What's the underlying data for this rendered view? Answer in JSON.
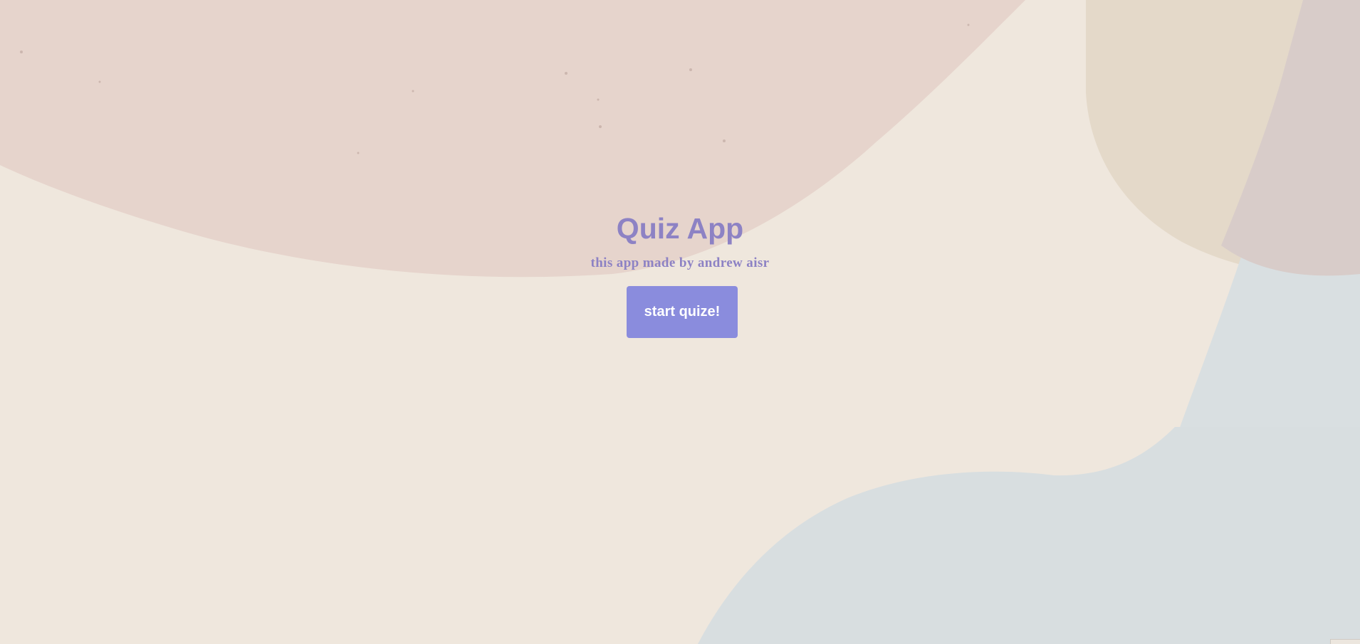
{
  "page": {
    "title": "Quiz App",
    "subtitle": "this app made by andrew aisr",
    "start_button_label": "start quize!"
  },
  "colors": {
    "background": "#efe7dd",
    "pink_blob": "#e6d4cc",
    "blue_blob": "#d7dde0",
    "tan_blob": "#e3d7c7",
    "accent_text": "#8d82c4",
    "button_bg": "#8a8cdd",
    "button_text": "#ffffff"
  }
}
